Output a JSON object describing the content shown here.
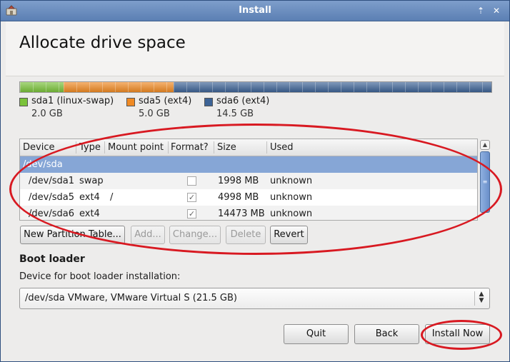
{
  "window": {
    "title": "Install",
    "maximize_glyph": "⇡",
    "close_glyph": "✕"
  },
  "page": {
    "heading": "Allocate drive space"
  },
  "disk": {
    "partitions": [
      {
        "name": "sda1 (linux-swap)",
        "size": "2.0 GB",
        "color": "#7ac23a",
        "fraction": 0.093
      },
      {
        "name": "sda5 (ext4)",
        "size": "5.0 GB",
        "color": "#f08a24",
        "fraction": 0.233
      },
      {
        "name": "sda6 (ext4)",
        "size": "14.5 GB",
        "color": "#3d6396",
        "fraction": 0.674
      }
    ]
  },
  "table": {
    "columns": [
      "Device",
      "Type",
      "Mount point",
      "Format?",
      "Size",
      "Used"
    ],
    "group": "/dev/sda",
    "rows": [
      {
        "device": "/dev/sda1",
        "type": "swap",
        "mount": "",
        "format": false,
        "size": "1998 MB",
        "used": "unknown"
      },
      {
        "device": "/dev/sda5",
        "type": "ext4",
        "mount": "/",
        "format": true,
        "size": "4998 MB",
        "used": "unknown"
      },
      {
        "device": "/dev/sda6",
        "type": "ext4",
        "mount": "",
        "format": true,
        "size": "14473 MB",
        "used": "unknown"
      }
    ],
    "checkmark": "✓",
    "scroll_up": "▲",
    "scroll_grip": "≡"
  },
  "partition_buttons": {
    "new_table": "New Partition Table...",
    "add": "Add...",
    "change": "Change...",
    "delete": "Delete",
    "revert": "Revert"
  },
  "bootloader": {
    "title": "Boot loader",
    "label": "Device for boot loader installation:",
    "selected": "/dev/sda VMware, VMware Virtual S (21.5 GB)",
    "arrow_up": "▲",
    "arrow_down": "▼"
  },
  "actions": {
    "quit": "Quit",
    "back": "Back",
    "install": "Install Now"
  },
  "annotations": {
    "color": "#d81921"
  }
}
